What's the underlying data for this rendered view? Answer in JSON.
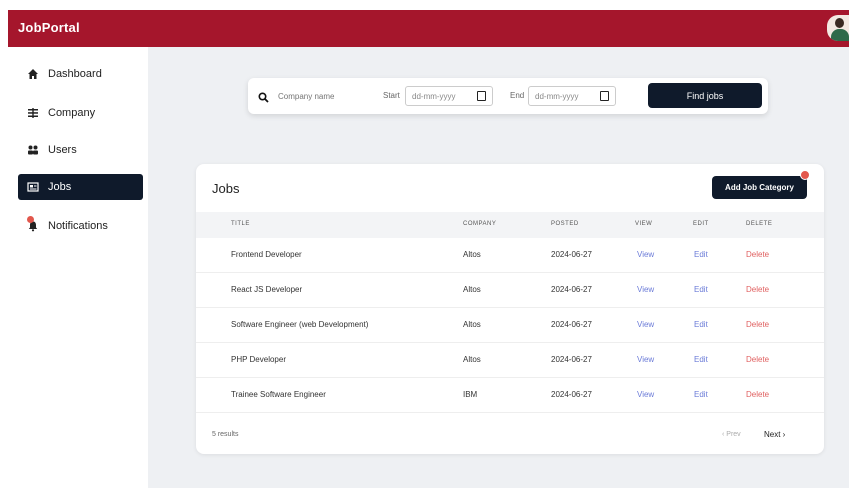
{
  "app": {
    "brand": "JobPortal"
  },
  "sidebar": {
    "items": [
      {
        "label": "Dashboard",
        "icon": "home-icon"
      },
      {
        "label": "Company",
        "icon": "building-icon"
      },
      {
        "label": "Users",
        "icon": "users-icon"
      },
      {
        "label": "Jobs",
        "icon": "jobs-icon",
        "active": true
      },
      {
        "label": "Notifications",
        "icon": "bell-icon"
      }
    ]
  },
  "search": {
    "company_placeholder": "Company name",
    "start_label": "Start",
    "start_value": "dd-mm-yyyy",
    "end_label": "End",
    "end_value": "dd-mm-yyyy",
    "find_label": "Find jobs"
  },
  "jobs": {
    "title": "Jobs",
    "add_category_label": "Add Job Category",
    "headers": [
      "TITLE",
      "COMPANY",
      "POSTED",
      "VIEW",
      "EDIT",
      "DELETE"
    ],
    "rows": [
      {
        "title": "Frontend Developer",
        "company": "Altos",
        "posted": "2024-06-27",
        "view": "View",
        "edit": "Edit",
        "delete": "Delete"
      },
      {
        "title": "React JS Developer",
        "company": "Altos",
        "posted": "2024-06-27",
        "view": "View",
        "edit": "Edit",
        "delete": "Delete"
      },
      {
        "title": "Software Engineer (web Development)",
        "company": "Altos",
        "posted": "2024-06-27",
        "view": "View",
        "edit": "Edit",
        "delete": "Delete"
      },
      {
        "title": "PHP Developer",
        "company": "Altos",
        "posted": "2024-06-27",
        "view": "View",
        "edit": "Edit",
        "delete": "Delete"
      },
      {
        "title": "Trainee Software Engineer",
        "company": "IBM",
        "posted": "2024-06-27",
        "view": "View",
        "edit": "Edit",
        "delete": "Delete"
      }
    ],
    "results_text": "5 results",
    "prev_label": "‹ Prev",
    "next_label": "Next ›"
  },
  "colors": {
    "brand": "#a5162c",
    "dark": "#0f1a2b",
    "link": "#6b7bd8",
    "danger": "#e06060"
  }
}
